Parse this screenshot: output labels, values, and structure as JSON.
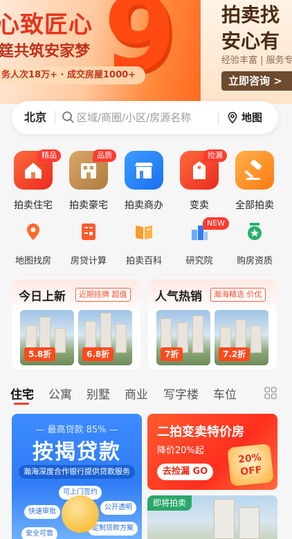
{
  "banner": {
    "main_title": "心致匠心",
    "main_subtitle": "筳共筑安家梦",
    "stats": "务人次18万+ · 成交房屋1000+",
    "big_number": "9",
    "side_title_1": "拍卖找",
    "side_title_2": "安心有",
    "side_desc": "经验丰富 | 服务专",
    "side_button": "立即咨询 >"
  },
  "search": {
    "city": "北京",
    "placeholder": "区域/商圈/小区/房源名称",
    "map_label": "地图"
  },
  "categories": [
    {
      "label": "拍卖住宅",
      "tag": "精品",
      "icon": "house-icon"
    },
    {
      "label": "拍卖豪宅",
      "tag": "品质",
      "icon": "villa-icon"
    },
    {
      "label": "拍卖商办",
      "tag": "",
      "icon": "shop-icon"
    },
    {
      "label": "变卖",
      "tag": "捡漏",
      "icon": "price-tag-icon"
    },
    {
      "label": "全部拍卖",
      "tag": "",
      "icon": "gavel-icon"
    }
  ],
  "tools": [
    {
      "label": "地图找房",
      "icon": "map-pin-icon",
      "tag": ""
    },
    {
      "label": "房贷计算",
      "icon": "calculator-icon",
      "tag": ""
    },
    {
      "label": "拍卖百科",
      "icon": "book-icon",
      "tag": ""
    },
    {
      "label": "研究院",
      "icon": "chart-icon",
      "tag": "NEW"
    },
    {
      "label": "购房资质",
      "icon": "certificate-icon",
      "tag": ""
    }
  ],
  "feature_cards": [
    {
      "title": "今日上新",
      "badge": "近期挂牌 超值",
      "items": [
        {
          "discount": "5.8折"
        },
        {
          "discount": "6.8折"
        }
      ]
    },
    {
      "title": "人气热销",
      "badge": "瀚海精选 价优",
      "items": [
        {
          "discount": "7折"
        },
        {
          "discount": "7.2折"
        }
      ]
    }
  ],
  "tabs": [
    "住宅",
    "公寓",
    "别墅",
    "商业",
    "写字楼",
    "车位"
  ],
  "loan_card": {
    "top": "— 最高贷款 85% —",
    "title": "按揭贷款",
    "desc": "瀚海深度合作银行提供贷款服务",
    "chips": [
      "可上门签约",
      "快速审批",
      "公开透明",
      "定制贷款方案",
      "安全可靠"
    ]
  },
  "promo_card": {
    "title": "二拍变卖特价房",
    "subtitle": "降价20%起",
    "button": "去捡漏 GO",
    "off_line1": "20%",
    "off_line2": "OFF"
  },
  "upcoming_card": {
    "tag": "即将拍卖"
  },
  "colors": {
    "accent": "#ff3b2f",
    "brand_blue": "#2f7cf5"
  }
}
